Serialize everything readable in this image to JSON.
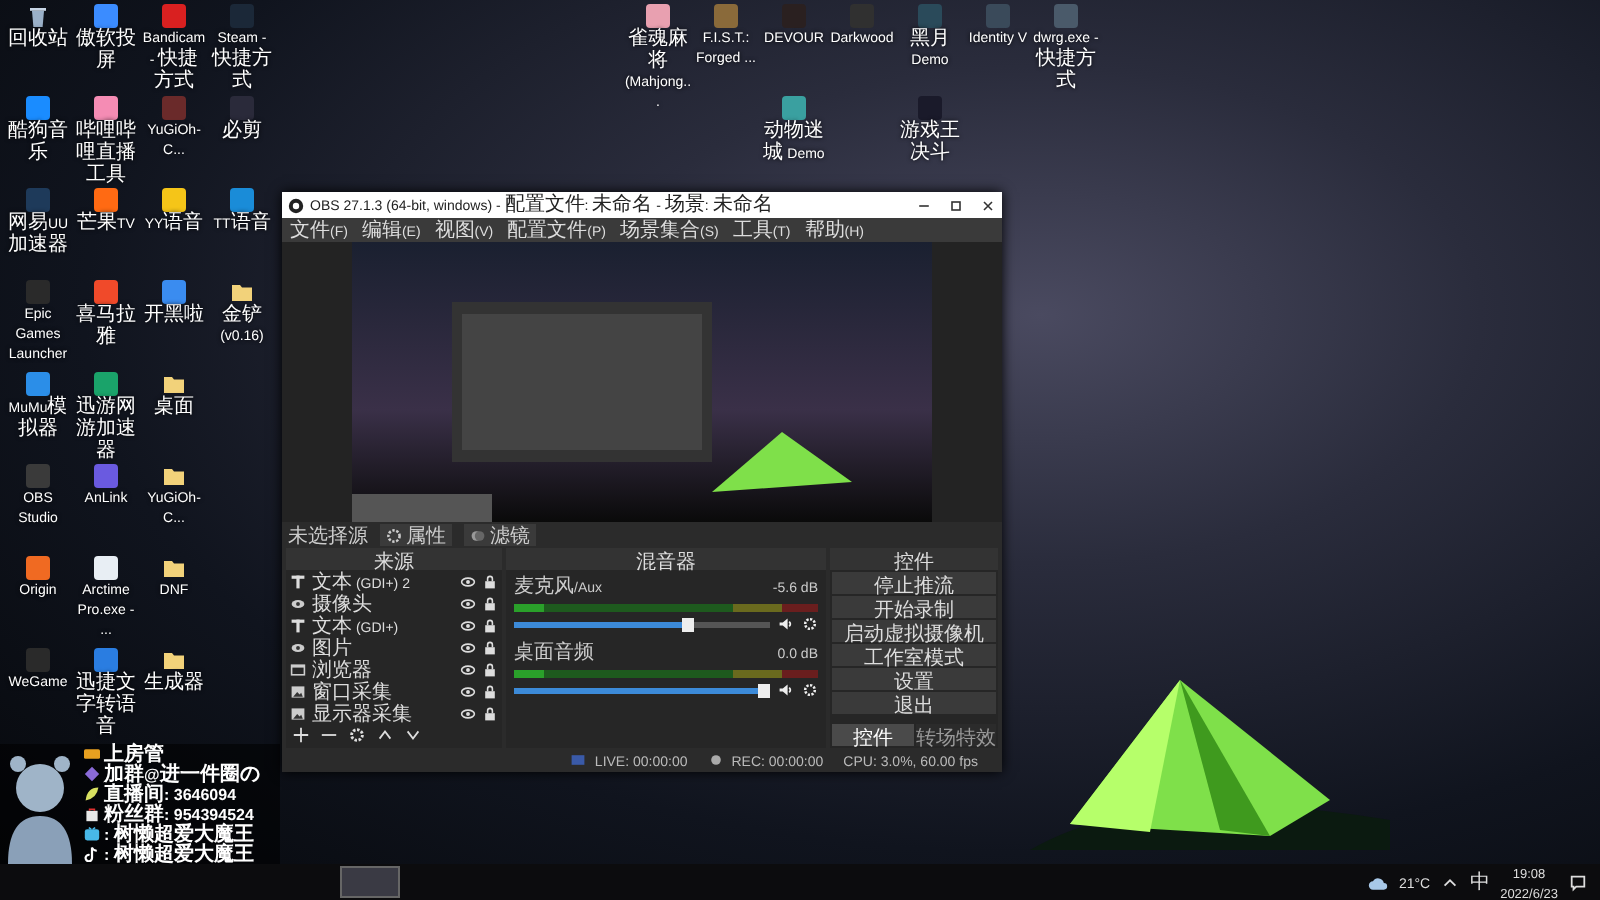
{
  "desktop_icons": [
    {
      "label": "回收站",
      "kind": "bin"
    },
    {
      "label": "酷狗音乐",
      "kind": "app",
      "color": "#1a8cff"
    },
    {
      "label": "网易UU加速器",
      "kind": "app",
      "color": "#1e3a5a"
    },
    {
      "label": "Epic Games Launcher",
      "kind": "app",
      "color": "#2a2a2a"
    },
    {
      "label": "MuMu模拟器",
      "kind": "app",
      "color": "#2b8ee8"
    },
    {
      "label": "OBS Studio",
      "kind": "app",
      "color": "#3a3a3a"
    },
    {
      "label": "Origin",
      "kind": "app",
      "color": "#f06a22"
    },
    {
      "label": "WeGame",
      "kind": "app",
      "color": "#2a2a2a"
    },
    {
      "label": "傲软投屏",
      "kind": "app",
      "color": "#3b8cff"
    },
    {
      "label": "哔哩哔哩直播工具",
      "kind": "app",
      "color": "#f58cb4"
    },
    {
      "label": "芒果TV",
      "kind": "app",
      "color": "#ff6a13"
    },
    {
      "label": "喜马拉雅",
      "kind": "app",
      "color": "#f04a2a"
    },
    {
      "label": "迅游网游加速器",
      "kind": "app",
      "color": "#1aa36a"
    },
    {
      "label": "AnLink",
      "kind": "app",
      "color": "#6a5ae0"
    },
    {
      "label": "Arctime Pro.exe - ...",
      "kind": "app",
      "color": "#e8eef4"
    },
    {
      "label": "迅捷文字转语音",
      "kind": "app",
      "color": "#2a7de1"
    },
    {
      "label": "Bandicam - 快捷方式",
      "kind": "app",
      "color": "#d92020"
    },
    {
      "label": "YuGiOh-C...",
      "kind": "app",
      "color": "#6a2a2a"
    },
    {
      "label": "YY语音",
      "kind": "app",
      "color": "#f5c518"
    },
    {
      "label": "开黑啦",
      "kind": "app",
      "color": "#3a8cf0"
    },
    {
      "label": "桌面",
      "kind": "folder"
    },
    {
      "label": "YuGiOh-C...",
      "kind": "folder"
    },
    {
      "label": "DNF",
      "kind": "folder"
    },
    {
      "label": "生成器",
      "kind": "folder"
    },
    {
      "label": "Steam - 快捷方式",
      "kind": "app",
      "color": "#1b2838"
    },
    {
      "label": "必剪",
      "kind": "app",
      "color": "#2a2a3a"
    },
    {
      "label": "TT语音",
      "kind": "app",
      "color": "#1a8cd8"
    },
    {
      "label": "金铲(v0.16)",
      "kind": "folder"
    }
  ],
  "top_icons": [
    {
      "label": "雀魂麻将 (Mahjong...",
      "kind": "app",
      "color": "#e8a0b0"
    },
    {
      "label": "F.I.S.T.: Forged ...",
      "kind": "app",
      "color": "#8a6a3a"
    },
    {
      "label": "DEVOUR",
      "kind": "app",
      "color": "#2a2020"
    },
    {
      "label": "Darkwood",
      "kind": "app",
      "color": "#303030"
    },
    {
      "label": "黑月 Demo",
      "kind": "app",
      "color": "#2a4a5a"
    },
    {
      "label": "Identity V",
      "kind": "app",
      "color": "#3a4a5a"
    },
    {
      "label": "dwrg.exe - 快捷方式",
      "kind": "app",
      "color": "#4a5a6a"
    }
  ],
  "top_icons_row2": [
    {
      "label": "动物迷城 Demo",
      "kind": "app",
      "color": "#3aa0a0"
    },
    {
      "label": "游戏王决斗",
      "kind": "app",
      "color": "#1a1a2a"
    }
  ],
  "obs": {
    "title": "OBS 27.1.3 (64-bit, windows) - 配置文件: 未命名 - 场景: 未命名",
    "menu": [
      "文件(F)",
      "编辑(E)",
      "视图(V)",
      "配置文件(P)",
      "场景集合(S)",
      "工具(T)",
      "帮助(H)"
    ],
    "source_bar": {
      "label": "未选择源",
      "buttons": [
        {
          "label": "属性",
          "kind": "properties"
        },
        {
          "label": "滤镜",
          "kind": "filters"
        }
      ]
    },
    "sources": {
      "title": "来源",
      "items": [
        {
          "name": "文本 (GDI+) 2",
          "kind": "text"
        },
        {
          "name": "摄像头",
          "kind": "camera"
        },
        {
          "name": "文本 (GDI+)",
          "kind": "text"
        },
        {
          "name": "图片",
          "kind": "camera"
        },
        {
          "name": "浏览器",
          "kind": "window"
        },
        {
          "name": "窗口采集",
          "kind": "image"
        },
        {
          "name": "显示器采集",
          "kind": "image"
        }
      ]
    },
    "mixer": {
      "title": "混音器",
      "channels": [
        {
          "name": "麦克风/Aux",
          "reading": "-5.6 dB",
          "level": 0.7
        },
        {
          "name": "桌面音频",
          "reading": "0.0 dB",
          "level": 1.0
        }
      ]
    },
    "controls": {
      "title": "控件",
      "buttons": [
        "停止推流",
        "开始录制",
        "启动虚拟摄像机",
        "工作室模式",
        "设置",
        "退出"
      ],
      "tabs": [
        {
          "label": "控件",
          "selected": true
        },
        {
          "label": "转场特效",
          "selected": false
        }
      ]
    },
    "status": {
      "live": "LIVE: 00:00:00",
      "rec": "REC: 00:00:00",
      "cpu": "CPU: 3.0%, 60.00 fps"
    }
  },
  "stream_overlay": {
    "lines": [
      {
        "kind": "badge",
        "text": "上房管"
      },
      {
        "kind": "group",
        "text": "加群@进一件圈の"
      },
      {
        "kind": "room",
        "text": "直播间: 3646094"
      },
      {
        "kind": "fans",
        "text": "粉丝群: 954394524"
      },
      {
        "kind": "bilibili",
        "text": ": 树懒超爱大魔王"
      },
      {
        "kind": "douyin",
        "text": ": 树懒超爱大魔王"
      }
    ]
  },
  "taskbar": {
    "weather": "21°C",
    "ime": "中",
    "time": "19:08",
    "date": "2022/6/23"
  }
}
